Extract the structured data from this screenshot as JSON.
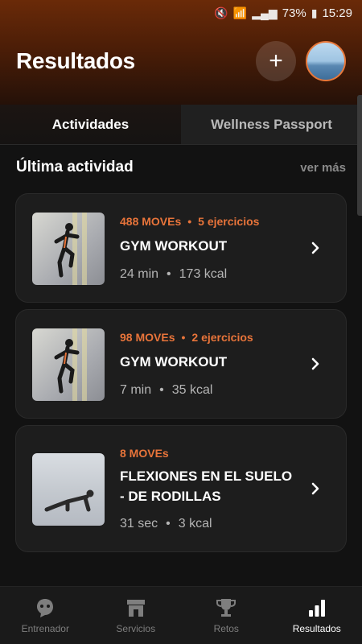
{
  "status_bar": {
    "battery_pct": "73%",
    "time": "15:29",
    "icons": [
      "mute-icon",
      "wifi-icon",
      "signal-icon",
      "battery-icon"
    ]
  },
  "header": {
    "title": "Resultados",
    "add_icon": "plus-icon"
  },
  "tabs": [
    {
      "label": "Actividades",
      "active": true
    },
    {
      "label": "Wellness Passport",
      "active": false
    }
  ],
  "section": {
    "title": "Última actividad",
    "see_more": "ver más"
  },
  "activities": [
    {
      "moves": "488 MOVEs",
      "exercises": "5 ejercicios",
      "title_lines": [
        "GYM WORKOUT"
      ],
      "duration": "24 min",
      "kcal": "173 kcal"
    },
    {
      "moves": "98 MOVEs",
      "exercises": "2 ejercicios",
      "title_lines": [
        "GYM WORKOUT"
      ],
      "duration": "7 min",
      "kcal": "35 kcal"
    },
    {
      "moves": "8 MOVEs",
      "exercises": "",
      "title_lines": [
        "FLEXIONES EN EL SUELO",
        "- DE RODILLAS"
      ],
      "duration": "31 sec",
      "kcal": "3 kcal"
    }
  ],
  "bottom_nav": [
    {
      "label": "Entrenador",
      "icon": "coach-icon",
      "active": false
    },
    {
      "label": "Servicios",
      "icon": "store-icon",
      "active": false
    },
    {
      "label": "Retos",
      "icon": "trophy-icon",
      "active": false
    },
    {
      "label": "Resultados",
      "icon": "bar-chart-icon",
      "active": true
    }
  ],
  "colors": {
    "accent": "#e8743a",
    "background": "#121212",
    "card": "#1d1d1d"
  }
}
